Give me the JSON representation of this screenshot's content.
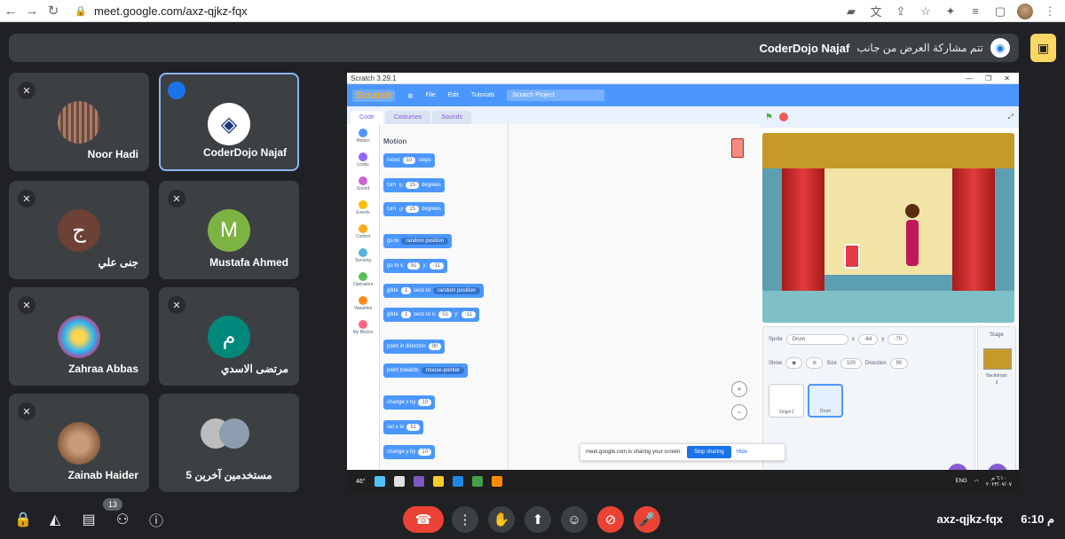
{
  "browser": {
    "url": "meet.google.com/axz-qjkz-fqx",
    "icons": [
      "back-icon",
      "forward-icon",
      "reload-icon",
      "lock-icon",
      "camera-icon",
      "translate-icon",
      "share-icon",
      "star-icon",
      "extensions-icon",
      "reading-list-icon",
      "side-panel-icon",
      "profile-avatar",
      "menu-icon"
    ]
  },
  "banner": {
    "presenter": "CoderDojo Najaf",
    "text": "تتم مشاركة العرض من جانب"
  },
  "participants": [
    {
      "name": "Noor Hadi",
      "muted": true
    },
    {
      "name": "CoderDojo Najaf",
      "muted": false,
      "active": true
    },
    {
      "name": "جنى علي",
      "initial": "ج",
      "muted": true
    },
    {
      "name": "Mustafa Ahmed",
      "initial": "M",
      "muted": true
    },
    {
      "name": "Zahraa Abbas",
      "muted": true
    },
    {
      "name": "مرتضى الاسدي",
      "initial": "م",
      "muted": true
    },
    {
      "name": "Zainab Haider",
      "muted": true
    },
    {
      "name": "5 مستخدمين آخرين",
      "muted": false
    }
  ],
  "screen": {
    "window_title": "Scratch 3.29.1",
    "menu": {
      "logo": "Scratch",
      "file": "File",
      "edit": "Edit",
      "tutorials": "Tutorials",
      "project_title": "Scratch Project"
    },
    "tabs": {
      "code": "Code",
      "costumes": "Costumes",
      "sounds": "Sounds"
    },
    "categories": [
      {
        "label": "Motion",
        "color": "#4c97ff"
      },
      {
        "label": "Looks",
        "color": "#9966ff"
      },
      {
        "label": "Sound",
        "color": "#cf63cf"
      },
      {
        "label": "Events",
        "color": "#ffbf00"
      },
      {
        "label": "Control",
        "color": "#ffab19"
      },
      {
        "label": "Sensing",
        "color": "#5cb1d6"
      },
      {
        "label": "Operators",
        "color": "#59c059"
      },
      {
        "label": "Variables",
        "color": "#ff8c1a"
      },
      {
        "label": "My Blocks",
        "color": "#ff6680"
      }
    ],
    "palette_title": "Motion",
    "blocks": {
      "move": "move",
      "move_val": "10",
      "steps": "steps",
      "turn": "turn",
      "turn_val": "15",
      "degrees": "degrees",
      "goto": "go to",
      "random_position": "random position",
      "goto_x": "go to x:",
      "x_val": "51",
      "y": "y:",
      "y_val": "-11",
      "glide": "glide",
      "glide_val": "1",
      "secs_to": "secs to",
      "secs_to_x": "secs to x:",
      "point_dir": "point in direction",
      "dir_val": "90",
      "point_towards": "point towards",
      "mouse_pointer": "mouse-pointer",
      "change_x": "change x by",
      "change_val": "10",
      "set_x": "set x to",
      "set_val": "51",
      "change_y": "change y by"
    },
    "sprite_info": {
      "sprite_label": "Sprite",
      "sprite_name": "Drum",
      "x": "-64",
      "y": "-70",
      "show": "Show",
      "size_label": "Size",
      "size": "100",
      "direction_label": "Direction",
      "direction": "90",
      "x_label": "x",
      "y_label": "y"
    },
    "sprites": [
      "Singer1",
      "Drum"
    ],
    "stage_pane": {
      "title": "Stage",
      "backdrops": "Backdrops",
      "backdrop_count": "3"
    },
    "sharing": {
      "text": "meet.google.com is sharing your screen.",
      "stop": "Stop sharing",
      "hide": "Hide"
    },
    "taskbar": {
      "temp": "46°",
      "lang": "ENG",
      "time": "٦:١٠ م",
      "date": "٢٠٢٣/٠٧/٠٧"
    }
  },
  "bottom": {
    "participants_count": "13",
    "meeting_code": "axz-qjkz-fqx",
    "clock": "6:10 م"
  }
}
